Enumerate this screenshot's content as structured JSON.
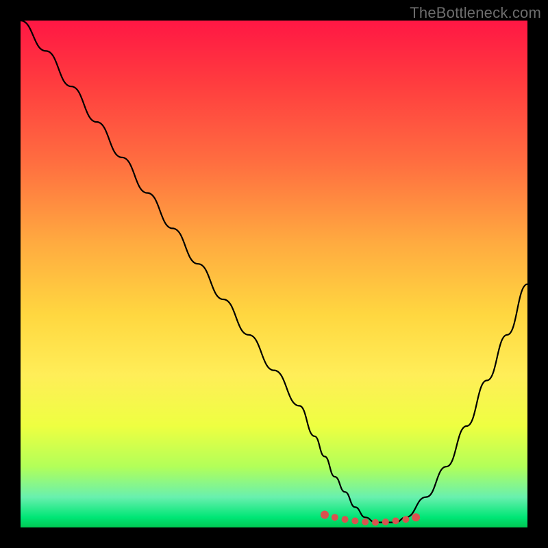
{
  "watermark": "TheBottleneck.com",
  "chart_data": {
    "type": "line",
    "title": "",
    "xlabel": "",
    "ylabel": "",
    "xlim": [
      0,
      100
    ],
    "ylim": [
      0,
      100
    ],
    "grid": false,
    "x": [
      0,
      5,
      10,
      15,
      20,
      25,
      30,
      35,
      40,
      45,
      50,
      55,
      58,
      60,
      62,
      64,
      66,
      68,
      70,
      72,
      74,
      76,
      80,
      84,
      88,
      92,
      96,
      100
    ],
    "values": [
      100,
      94,
      87,
      80,
      73,
      66,
      59,
      52,
      45,
      38,
      31,
      24,
      18,
      14,
      10,
      7,
      4,
      2,
      1,
      1,
      1,
      2,
      6,
      12,
      20,
      29,
      38,
      48
    ],
    "markers": {
      "x": [
        60,
        62,
        64,
        66,
        68,
        70,
        72,
        74,
        76,
        78
      ],
      "y": [
        2.5,
        2.0,
        1.6,
        1.3,
        1.1,
        1.0,
        1.1,
        1.3,
        1.6,
        2.0
      ]
    },
    "colors": {
      "curve": "#000000",
      "marker": "#d9534f",
      "gradient_top": "#ff1744",
      "gradient_bottom": "#00c853"
    }
  }
}
